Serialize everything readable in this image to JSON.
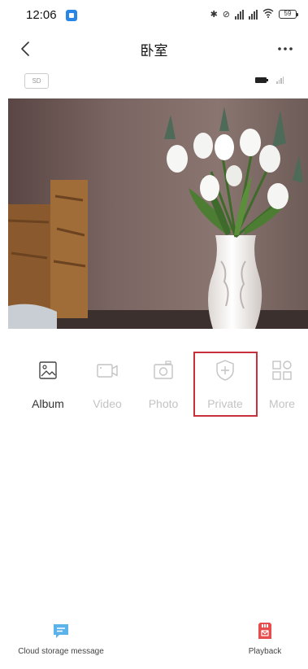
{
  "status_bar": {
    "time": "12:06",
    "battery": "59"
  },
  "nav": {
    "title": "卧室"
  },
  "info_bar": {
    "sd_label": "SD"
  },
  "tools": [
    {
      "label": "Album",
      "icon": "album-icon",
      "enabled": true
    },
    {
      "label": "Video",
      "icon": "video-camera-icon",
      "enabled": false
    },
    {
      "label": "Photo",
      "icon": "camera-icon",
      "enabled": false
    },
    {
      "label": "Private",
      "icon": "shield-plus-icon",
      "enabled": false,
      "highlighted": true
    },
    {
      "label": "More",
      "icon": "grid-icon",
      "enabled": false
    }
  ],
  "bottom_bar": {
    "cloud_label": "Cloud storage message",
    "playback_label": "Playback"
  },
  "colors": {
    "highlight_border": "#c8313c",
    "cloud_icon": "#5bb3ea",
    "playback_icon": "#e84d4d",
    "disabled_text": "#c3c3c3"
  }
}
